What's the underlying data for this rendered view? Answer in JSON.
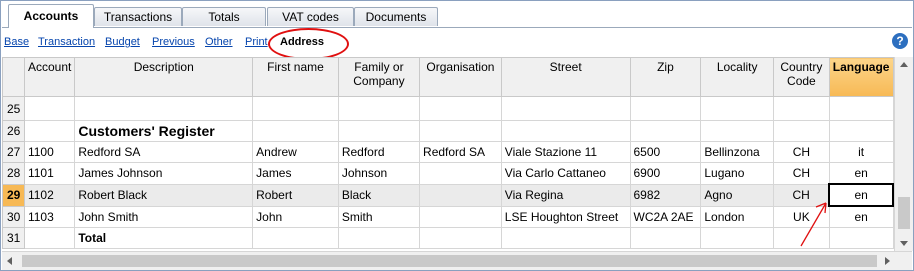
{
  "tabs": [
    {
      "label": "Accounts",
      "active": true
    },
    {
      "label": "Transactions"
    },
    {
      "label": "Totals"
    },
    {
      "label": "VAT codes"
    },
    {
      "label": "Documents"
    }
  ],
  "views": [
    {
      "label": "Base"
    },
    {
      "label": "Transaction"
    },
    {
      "label": "Budget"
    },
    {
      "label": "Previous"
    },
    {
      "label": "Other"
    },
    {
      "label": "Print"
    },
    {
      "label": "Address",
      "active": true
    }
  ],
  "help_icon": "?",
  "columns": [
    "",
    "Account",
    "Description",
    "First name",
    "Family or Company",
    "Organisation",
    "Street",
    "Zip",
    "Locality",
    "Country Code",
    "Language"
  ],
  "rows": [
    {
      "n": "25",
      "cells": [
        "",
        "",
        "",
        "",
        "",
        "",
        "",
        "",
        "",
        ""
      ]
    },
    {
      "n": "26",
      "cells": [
        "",
        "Customers' Register",
        "",
        "",
        "",
        "",
        "",
        "",
        "",
        ""
      ]
    },
    {
      "n": "27",
      "cells": [
        "1100",
        "Redford SA",
        "Andrew",
        "Redford",
        "Redford SA",
        "Viale Stazione 11",
        "6500",
        "Bellinzona",
        "CH",
        "it"
      ]
    },
    {
      "n": "28",
      "cells": [
        "1101",
        "James Johnson",
        "James",
        "Johnson",
        "",
        "Via Carlo Cattaneo",
        "6900",
        "Lugano",
        "CH",
        "en"
      ]
    },
    {
      "n": "29",
      "cells": [
        "1102",
        "Robert Black",
        "Robert",
        "Black",
        "",
        "Via Regina",
        "6982",
        "Agno",
        "CH",
        "en"
      ]
    },
    {
      "n": "30",
      "cells": [
        "1103",
        "John Smith",
        "John",
        "Smith",
        "",
        "LSE Houghton Street",
        "WC2A 2AE",
        "London",
        "UK",
        "en"
      ]
    },
    {
      "n": "31",
      "cells": [
        "",
        "Total",
        "",
        "",
        "",
        "",
        "",
        "",
        "",
        ""
      ]
    }
  ],
  "colors": {
    "accent_tab": "#f7b955",
    "annotation": "#e01010",
    "link": "#0645ad"
  }
}
